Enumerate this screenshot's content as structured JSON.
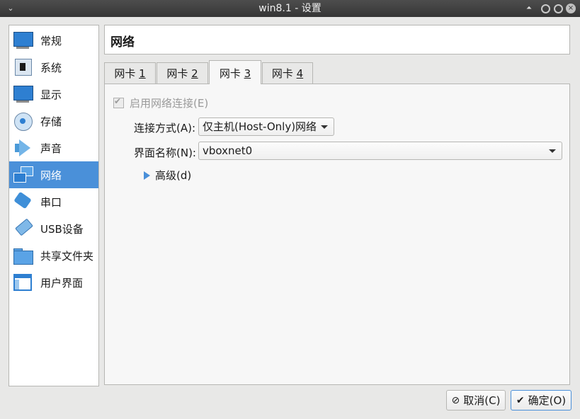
{
  "window": {
    "title": "win8.1 - 设置",
    "menu_glyph": "⌄",
    "controls": {
      "up": "⏶",
      "close": "×"
    }
  },
  "sidebar": {
    "items": [
      {
        "label": "常规",
        "icon": "monitor-icon"
      },
      {
        "label": "系统",
        "icon": "chip-icon"
      },
      {
        "label": "显示",
        "icon": "display-icon"
      },
      {
        "label": "存储",
        "icon": "storage-disk-icon"
      },
      {
        "label": "声音",
        "icon": "speaker-icon"
      },
      {
        "label": "网络",
        "icon": "network-icon",
        "selected": true
      },
      {
        "label": "串口",
        "icon": "serial-port-icon"
      },
      {
        "label": "USB设备",
        "icon": "usb-icon"
      },
      {
        "label": "共享文件夹",
        "icon": "folder-icon"
      },
      {
        "label": "用户界面",
        "icon": "window-icon"
      }
    ]
  },
  "header": {
    "title": "网络"
  },
  "tabs": [
    {
      "text": "网卡 ",
      "accel": "1"
    },
    {
      "text": "网卡 ",
      "accel": "2"
    },
    {
      "text": "网卡 ",
      "accel": "3",
      "active": true
    },
    {
      "text": "网卡 ",
      "accel": "4"
    }
  ],
  "adapter": {
    "enable": {
      "label": "启用网络连接(E)",
      "checked": true,
      "disabled": true
    },
    "attached_to": {
      "label": "连接方式(A):",
      "value": "仅主机(Host-Only)网络"
    },
    "name": {
      "label": "界面名称(N):",
      "value": "vboxnet0"
    },
    "advanced": {
      "label": "高级(d)"
    }
  },
  "buttons": {
    "cancel": {
      "label": "取消(C)",
      "icon": "⊘"
    },
    "ok": {
      "label": "确定(O)",
      "icon": "✔"
    }
  },
  "colors": {
    "accent": "#4a90d9",
    "titlebar": "#3b3b3b"
  }
}
